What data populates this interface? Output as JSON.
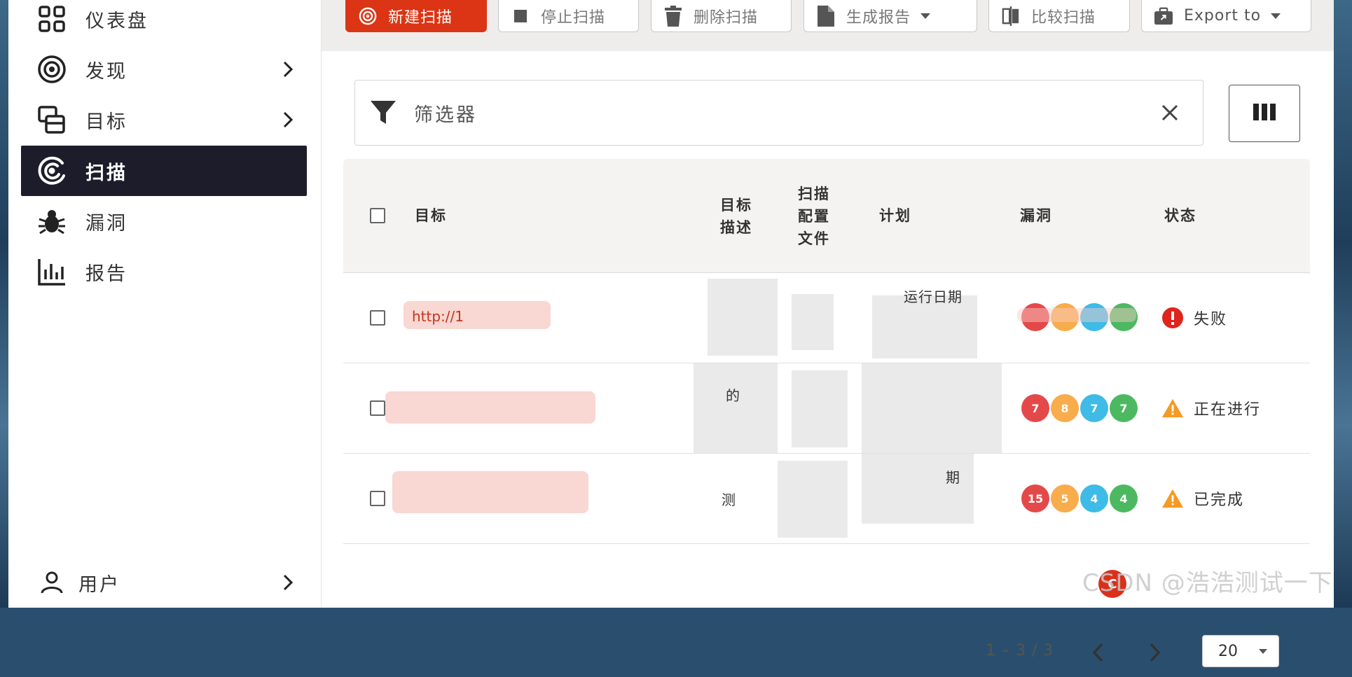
{
  "sidebar": {
    "items": [
      {
        "label": "仪表盘",
        "icon": "dashboard-icon",
        "has_chevron": false
      },
      {
        "label": "发现",
        "icon": "target-discover-icon",
        "has_chevron": true
      },
      {
        "label": "目标",
        "icon": "targets-icon",
        "has_chevron": true
      },
      {
        "label": "扫描",
        "icon": "scan-icon",
        "has_chevron": false,
        "active": true
      },
      {
        "label": "漏洞",
        "icon": "bug-icon",
        "has_chevron": false
      },
      {
        "label": "报告",
        "icon": "chart-icon",
        "has_chevron": false
      }
    ],
    "user_item": {
      "label": "用户",
      "icon": "user-icon"
    }
  },
  "toolbar": {
    "new_scan": "新建扫描",
    "stop_scan": "停止扫描",
    "delete_scan": "删除扫描",
    "generate_report": "生成报告",
    "compare_scans": "比较扫描",
    "export_to": "Export to"
  },
  "filter": {
    "placeholder": "筛选器"
  },
  "table": {
    "headers": {
      "target": "目标",
      "target_desc": [
        "目标",
        "描述"
      ],
      "scan_profile": [
        "扫描",
        "配置",
        "文件"
      ],
      "schedule": "计划",
      "vulnerabilities": "漏洞",
      "status": "状态"
    },
    "rows": [
      {
        "target": "http://1",
        "desc": "",
        "schedule_line1": "运行日期",
        "vulns": [
          "",
          "",
          "",
          ""
        ],
        "status": "失败",
        "status_type": "failed"
      },
      {
        "target": "",
        "desc_line1": "的",
        "desc_line2": "",
        "schedule_line1": "",
        "vulns": [
          "7",
          "8",
          "7",
          "7"
        ],
        "status": "正在进行",
        "status_type": "warning"
      },
      {
        "target": "",
        "desc_line1": "测",
        "schedule_line1": "期",
        "vulns": [
          "15",
          "5",
          "4",
          "4"
        ],
        "status": "已完成",
        "status_type": "warning"
      }
    ]
  },
  "pagination": {
    "count": "1 – 3 / 3",
    "page_size": "20"
  },
  "colors": {
    "accent": "#dc3515",
    "critical": "#e4494a",
    "high": "#f8ac4c",
    "medium": "#3ebbe6",
    "low": "#4cb961",
    "sidebar_active": "#1c1c2b"
  },
  "watermark": {
    "text": "CSDN @浩浩测试一下"
  }
}
